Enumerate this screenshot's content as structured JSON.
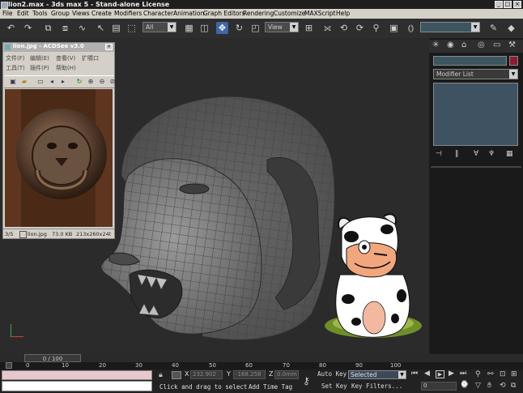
{
  "app": {
    "title": "lion2.max - 3ds max 5 - Stand-alone License",
    "window_buttons": [
      "_",
      "□",
      "×"
    ]
  },
  "menu": [
    "File",
    "Edit",
    "Tools",
    "Group",
    "Views",
    "Create",
    "Modifiers",
    "Character",
    "Animation",
    "Graph Editors",
    "Rendering",
    "Customize",
    "MAXScript",
    "Help"
  ],
  "toolbar": {
    "selection_filter": "All",
    "reference_coord": "View"
  },
  "command_panel": {
    "modifier_list_label": "Modifier List"
  },
  "acdsee": {
    "title": "lion.jpg - ACDSee v3.0",
    "menu_row1": [
      "文件(F)",
      "编辑(E)",
      "查看(V)",
      "扩嚼口"
    ],
    "menu_row2": [
      "工具(T)",
      "插件(P)",
      "帮助(H)"
    ],
    "status": {
      "index": "3/5",
      "filename": "lion.jpg",
      "filesize": "73.0 KB",
      "dimensions": "213x260x24t"
    }
  },
  "timeline": {
    "frame_display": "0 / 100",
    "ruler_ticks": [
      "0",
      "10",
      "20",
      "30",
      "40",
      "50",
      "60",
      "70",
      "80",
      "90",
      "100"
    ]
  },
  "status": {
    "x_label": "X",
    "x_value": "232.902",
    "y_label": "Y",
    "y_value": "-168.258",
    "z_label": "Z",
    "z_value": "0.0mm",
    "prompt": "Click and drag to select",
    "add_time_tag": "Add Time Tag",
    "auto_key_label": "Auto Key",
    "auto_key_value": "Selected",
    "set_key_label": "Set Key",
    "key_filters": "Key Filters...",
    "current_frame": "0"
  }
}
